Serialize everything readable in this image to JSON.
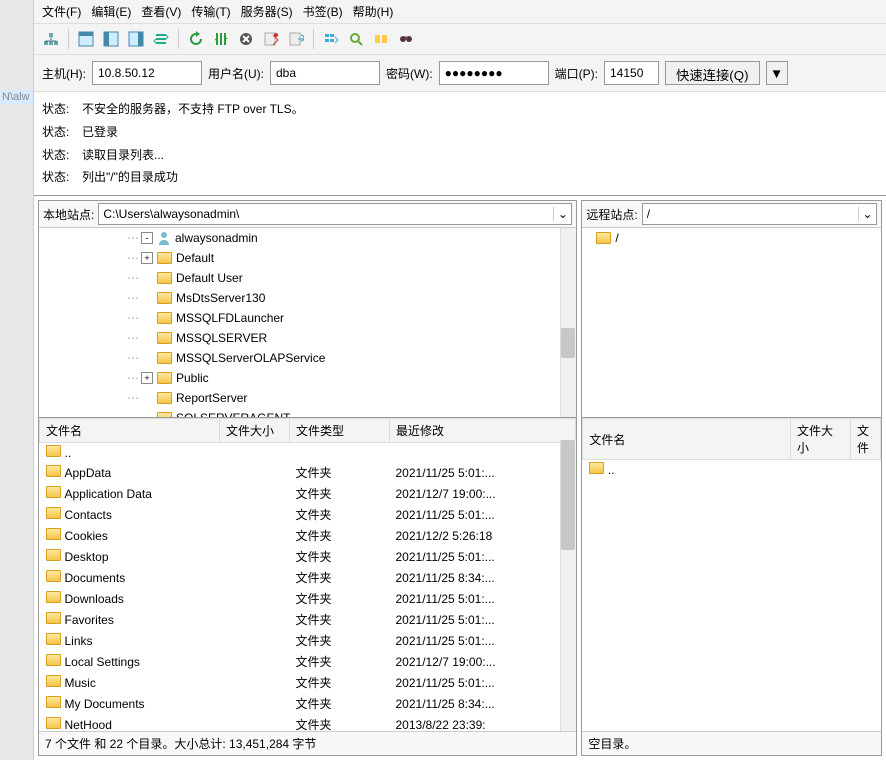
{
  "menu": [
    "文件(F)",
    "编辑(E)",
    "查看(V)",
    "传输(T)",
    "服务器(S)",
    "书签(B)",
    "帮助(H)"
  ],
  "conn": {
    "host_label": "主机(H):",
    "host": "10.8.50.12",
    "user_label": "用户名(U):",
    "user": "dba",
    "pass_label": "密码(W):",
    "pass": "●●●●●●●●",
    "port_label": "端口(P):",
    "port": "14150",
    "quick": "快速连接(Q)",
    "dd": "▼"
  },
  "log_key": "状态:",
  "log": [
    "不安全的服务器，不支持 FTP over TLS。",
    "已登录",
    "读取目录列表...",
    "列出\"/\"的目录成功"
  ],
  "local": {
    "label": "本地站点:",
    "path": "C:\\Users\\alwaysonadmin\\",
    "tree": [
      {
        "indent": 1,
        "collapser": "-",
        "icon": "user",
        "name": "alwaysonadmin"
      },
      {
        "indent": 1,
        "collapser": "+",
        "icon": "folder",
        "name": "Default"
      },
      {
        "indent": 1,
        "collapser": "",
        "icon": "folder",
        "name": "Default User"
      },
      {
        "indent": 1,
        "collapser": "",
        "icon": "folder",
        "name": "MsDtsServer130"
      },
      {
        "indent": 1,
        "collapser": "",
        "icon": "folder",
        "name": "MSSQLFDLauncher"
      },
      {
        "indent": 1,
        "collapser": "",
        "icon": "folder",
        "name": "MSSQLSERVER"
      },
      {
        "indent": 1,
        "collapser": "",
        "icon": "folder",
        "name": "MSSQLServerOLAPService"
      },
      {
        "indent": 1,
        "collapser": "+",
        "icon": "folder",
        "name": "Public"
      },
      {
        "indent": 1,
        "collapser": "",
        "icon": "folder",
        "name": "ReportServer"
      },
      {
        "indent": 1,
        "collapser": "",
        "icon": "folder",
        "name": "SQLSERVERAGENT"
      }
    ],
    "cols": [
      "文件名",
      "文件大小",
      "文件类型",
      "最近修改"
    ],
    "up": "..",
    "rows": [
      {
        "name": "AppData",
        "type": "文件夹",
        "mtime": "2021/11/25 5:01:..."
      },
      {
        "name": "Application Data",
        "type": "文件夹",
        "mtime": "2021/12/7 19:00:..."
      },
      {
        "name": "Contacts",
        "type": "文件夹",
        "mtime": "2021/11/25 5:01:..."
      },
      {
        "name": "Cookies",
        "type": "文件夹",
        "mtime": "2021/12/2 5:26:18"
      },
      {
        "name": "Desktop",
        "type": "文件夹",
        "mtime": "2021/11/25 5:01:..."
      },
      {
        "name": "Documents",
        "type": "文件夹",
        "mtime": "2021/11/25 8:34:..."
      },
      {
        "name": "Downloads",
        "type": "文件夹",
        "mtime": "2021/11/25 5:01:..."
      },
      {
        "name": "Favorites",
        "type": "文件夹",
        "mtime": "2021/11/25 5:01:..."
      },
      {
        "name": "Links",
        "type": "文件夹",
        "mtime": "2021/11/25 5:01:..."
      },
      {
        "name": "Local Settings",
        "type": "文件夹",
        "mtime": "2021/12/7 19:00:..."
      },
      {
        "name": "Music",
        "type": "文件夹",
        "mtime": "2021/11/25 5:01:..."
      },
      {
        "name": "My Documents",
        "type": "文件夹",
        "mtime": "2021/11/25 8:34:..."
      },
      {
        "name": "NetHood",
        "type": "文件夹",
        "mtime": "2013/8/22 23:39:"
      }
    ],
    "status": "7 个文件 和 22 个目录。大小总计: 13,451,284 字节"
  },
  "remote": {
    "label": "远程站点:",
    "path": "/",
    "root": "/",
    "cols": [
      "文件名",
      "文件大小",
      "文件"
    ],
    "up": "..",
    "status": "空目录。"
  },
  "gutter": {
    "sel": "N\\alw"
  }
}
